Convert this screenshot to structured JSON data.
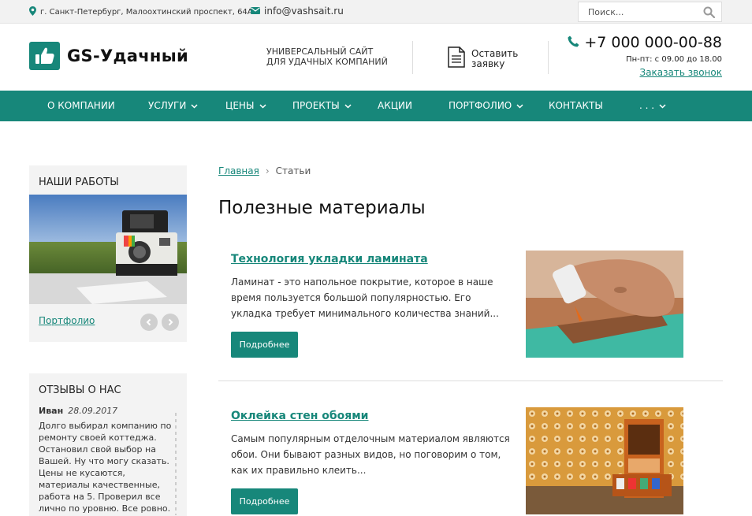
{
  "topbar": {
    "address": "г. Санкт-Петербург, Малоохтинский проспект, 64А",
    "email": "info@vashsait.ru",
    "search_placeholder": "Поиск..."
  },
  "header": {
    "logo_text": "GS-Удачный",
    "tagline_line1": "Универсальный сайт",
    "tagline_line2": "для удачных компаний",
    "apply_line1": "Оставить",
    "apply_line2": "заявку",
    "phone": "+7 000 000-00-88",
    "hours": "Пн-пт: с 09.00 до 18.00",
    "callback": "Заказать звонок"
  },
  "nav": {
    "items": [
      {
        "label": "О компании"
      },
      {
        "label": "Услуги"
      },
      {
        "label": "Цены"
      },
      {
        "label": "Проекты"
      },
      {
        "label": "Акции"
      },
      {
        "label": "Портфолио"
      },
      {
        "label": "Контакты"
      },
      {
        "label": ". . ."
      }
    ]
  },
  "sidebar": {
    "works_title": "Наши работы",
    "works_link": "Портфолио",
    "reviews_title": "Отзывы о нас",
    "review_author": "Иван",
    "review_date": "28.09.2017",
    "review_text": "Долго выбирал компанию по ремонту своей коттеджа. Остановил свой выбор на Вашей. Ну что могу сказать. Цены не кусаются, материалы качественные, работа на 5. Проверил все лично по уровню. Все ровно. Крепко. Буду рекомендовать Вас своим"
  },
  "main": {
    "breadcrumb_home": "Главная",
    "breadcrumb_current": "Статьи",
    "title": "Полезные материалы",
    "articles": [
      {
        "title": "Технология укладки ламината",
        "text": "Ламинат - это напольное покрытие, которое в наше время пользуется большой популярностью. Его укладка требует минимального количества знаний...",
        "button": "Подробнее"
      },
      {
        "title": "Оклейка стен обоями",
        "text": "Самым популярным отделочным материалом являются обои. Они бывают разных видов, но поговорим о том, как их правильно клеить...",
        "button": "Подробнее"
      }
    ]
  },
  "colors": {
    "accent": "#17877a"
  }
}
